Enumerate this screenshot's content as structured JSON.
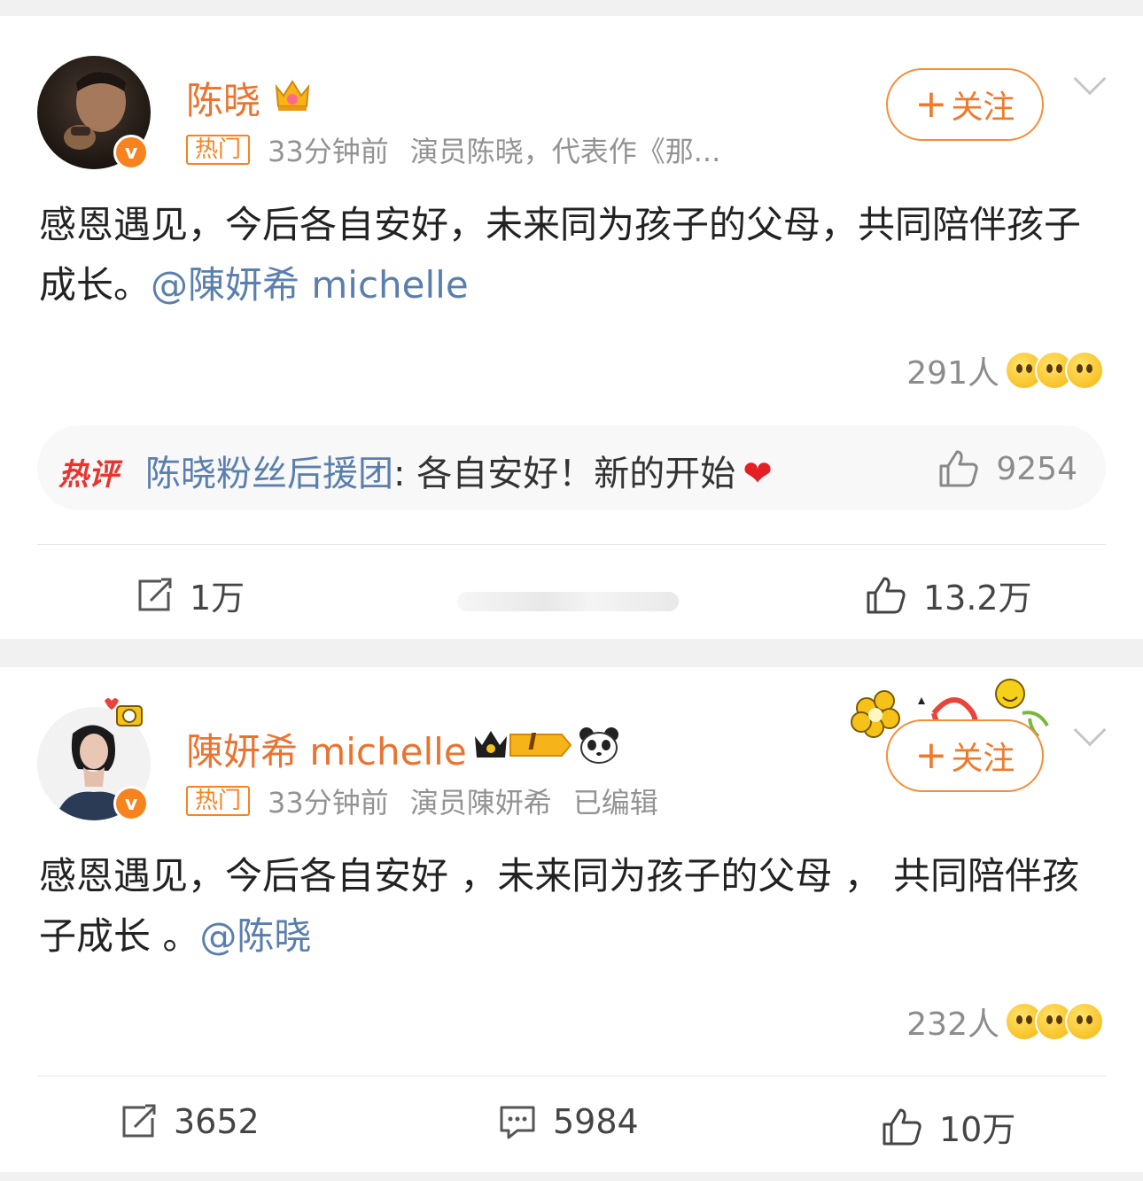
{
  "posts": [
    {
      "author": "陈晓",
      "hot_tag": "热门",
      "time": "33分钟前",
      "source": "演员陈晓，代表作《那...",
      "edited": "",
      "follow_label": "关注",
      "text": "感恩遇见，今后各自安好，未来同为孩子的父母，共同陪伴孩子成长。",
      "mention": "@陳妍希 michelle",
      "reaction_count": "291人",
      "hot_comment": {
        "label": "热评",
        "author": "陈晓粉丝后援团",
        "content": ": 各自安好！新的开始",
        "likes": "9254"
      },
      "actions": {
        "reposts": "1万",
        "comments": "",
        "likes": "13.2万"
      }
    },
    {
      "author": "陳妍希 michelle",
      "hot_tag": "热门",
      "time": "33分钟前",
      "source": "演员陳妍希",
      "edited": "已编辑",
      "follow_label": "关注",
      "text": "感恩遇见，今后各自安好 ，未来同为孩子的父母 ， 共同陪伴孩子成长 。",
      "mention": "@陈晓",
      "reaction_count": "232人",
      "level_badge": "I",
      "actions": {
        "reposts": "3652",
        "comments": "5984",
        "likes": "10万"
      }
    }
  ],
  "colors": {
    "accent": "#f07a2a",
    "link": "#5a7fae",
    "hot_red": "#e8332e"
  }
}
